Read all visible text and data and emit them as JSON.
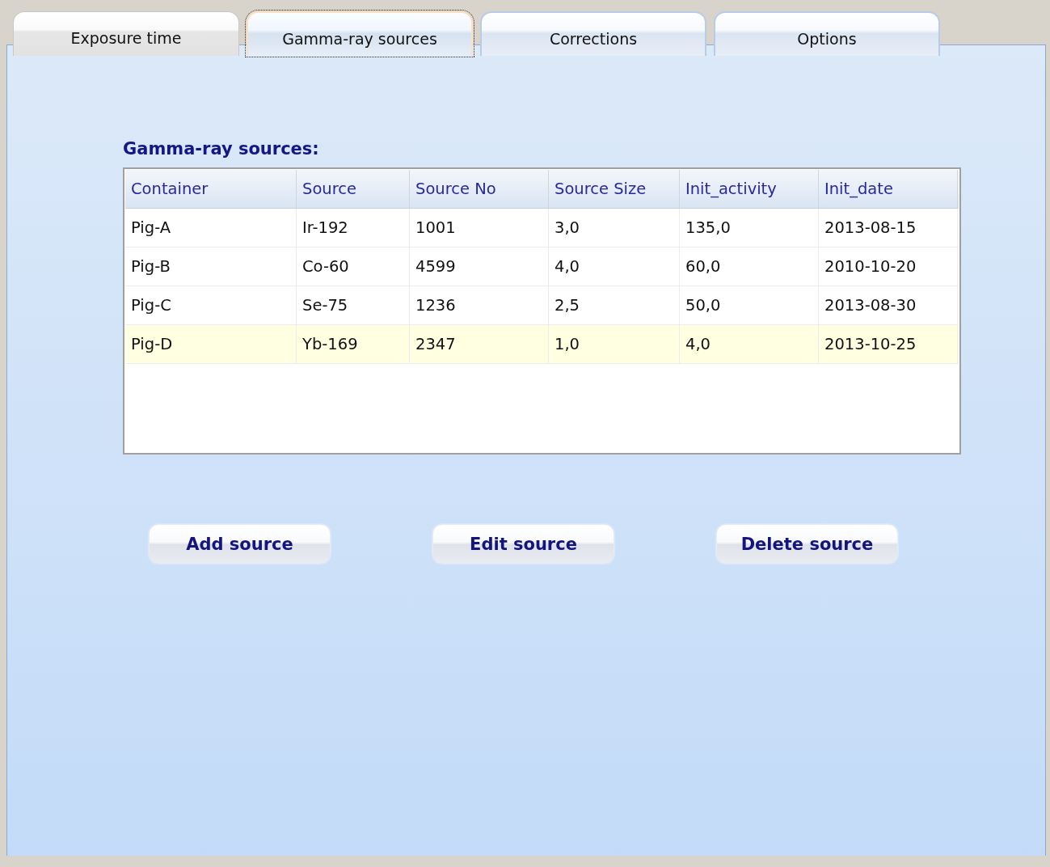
{
  "tabs": [
    {
      "label": "Exposure time",
      "selected": false
    },
    {
      "label": "Gamma-ray sources",
      "selected": true
    },
    {
      "label": "Corrections",
      "selected": false
    },
    {
      "label": "Options",
      "selected": false
    }
  ],
  "section_title": "Gamma-ray sources:",
  "table": {
    "columns": [
      "Container",
      "Source",
      "Source No",
      "Source Size",
      "Init_activity",
      "Init_date"
    ],
    "rows": [
      {
        "cells": [
          "Pig-A",
          "Ir-192",
          "1001",
          "3,0",
          "135,0",
          "2013-08-15"
        ],
        "selected": false
      },
      {
        "cells": [
          "Pig-B",
          "Co-60",
          "4599",
          "4,0",
          "60,0",
          "2010-10-20"
        ],
        "selected": false
      },
      {
        "cells": [
          "Pig-C",
          "Se-75",
          "1236",
          "2,5",
          "50,0",
          "2013-08-30"
        ],
        "selected": false
      },
      {
        "cells": [
          "Pig-D",
          "Yb-169",
          "2347",
          "1,0",
          "4,0",
          "2013-10-25"
        ],
        "selected": true
      }
    ]
  },
  "buttons": [
    "Add source",
    "Edit source",
    "Delete source"
  ]
}
